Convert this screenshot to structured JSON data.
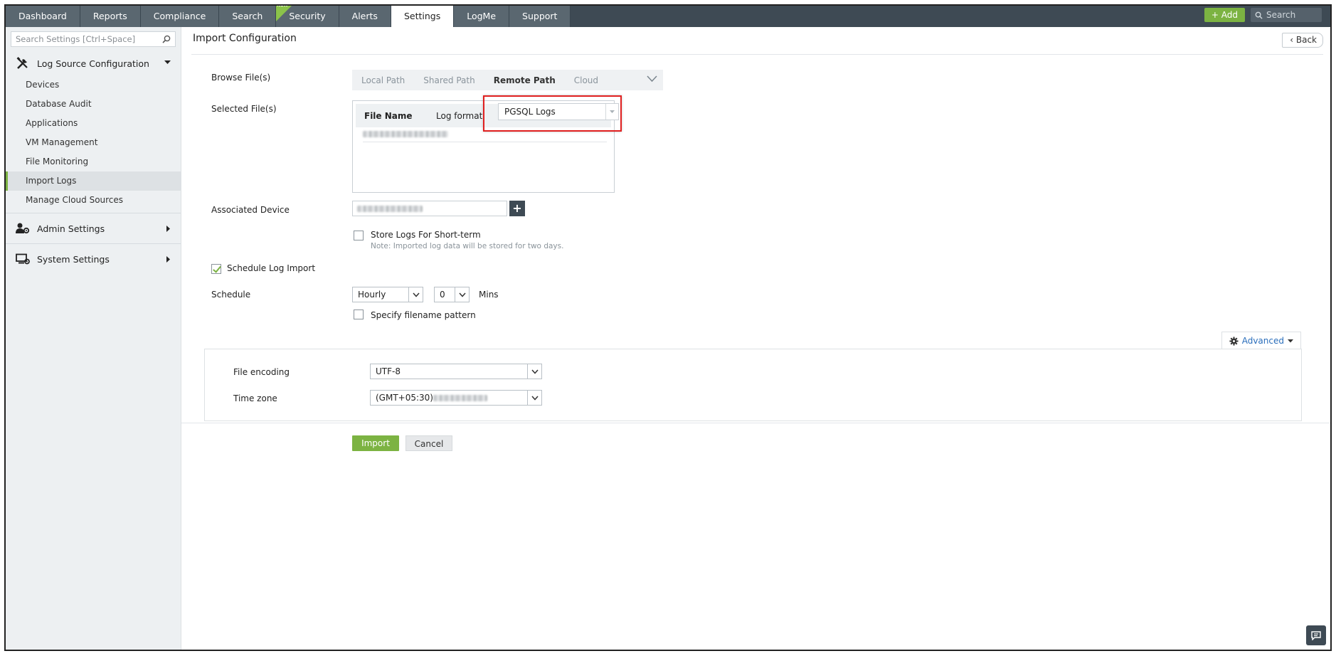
{
  "nav": {
    "tabs": [
      {
        "label": "Dashboard"
      },
      {
        "label": "Reports"
      },
      {
        "label": "Compliance"
      },
      {
        "label": "Search"
      },
      {
        "label": "Security",
        "badge": "NEW"
      },
      {
        "label": "Alerts"
      },
      {
        "label": "Settings",
        "active": true
      },
      {
        "label": "LogMe"
      },
      {
        "label": "Support"
      }
    ],
    "add_label": "+ Add",
    "search_placeholder": "Search"
  },
  "sidebar": {
    "search_placeholder": "Search Settings [Ctrl+Space]",
    "log_source": {
      "title": "Log Source Configuration",
      "items": [
        {
          "label": "Devices"
        },
        {
          "label": "Database Audit"
        },
        {
          "label": "Applications"
        },
        {
          "label": "VM Management"
        },
        {
          "label": "File Monitoring"
        },
        {
          "label": "Import Logs",
          "active": true
        },
        {
          "label": "Manage Cloud Sources"
        }
      ]
    },
    "admin_settings": "Admin Settings",
    "system_settings": "System Settings"
  },
  "page": {
    "title": "Import Configuration",
    "back_label": "Back"
  },
  "form": {
    "browse_label": "Browse File(s)",
    "browse_tabs": [
      "Local Path",
      "Shared Path",
      "Remote Path",
      "Cloud"
    ],
    "browse_active": "Remote Path",
    "selected_label": "Selected File(s)",
    "col_file_name": "File Name",
    "col_log_format": "Log format",
    "log_format_value": "PGSQL Logs",
    "device_label": "Associated Device",
    "short_term_label": "Store Logs For Short-term",
    "short_term_note": "Note: Imported log data will be stored for two days.",
    "schedule_import_label": "Schedule Log Import",
    "schedule_import_checked": true,
    "schedule_label": "Schedule",
    "schedule_freq": "Hourly",
    "schedule_mins": "0",
    "mins_label": "Mins",
    "filename_pattern_label": "Specify filename pattern",
    "advanced_label": "Advanced",
    "encoding_label": "File encoding",
    "encoding_value": "UTF-8",
    "timezone_label": "Time zone",
    "timezone_value": "(GMT+05:30)",
    "import_label": "Import",
    "cancel_label": "Cancel"
  },
  "colors": {
    "accent": "#7cb342",
    "nav_bg": "#3e4a54",
    "highlight": "#e02020",
    "link": "#2a6ebb"
  }
}
